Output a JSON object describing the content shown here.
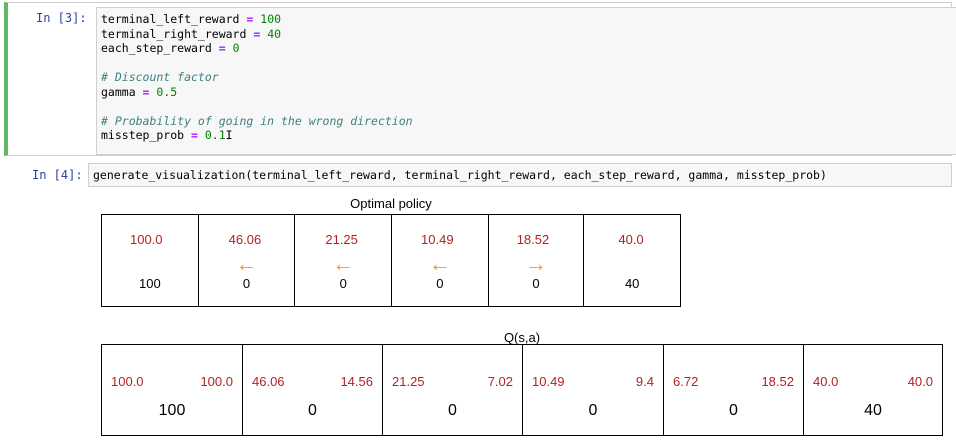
{
  "cell3": {
    "prompt": "In [3]:",
    "lines": [
      {
        "name": "terminal_left_reward",
        "op": " = ",
        "val": "100"
      },
      {
        "name": "terminal_right_reward",
        "op": " = ",
        "val": "40"
      },
      {
        "name": "each_step_reward",
        "op": " = ",
        "val": "0"
      },
      {
        "comment": ""
      },
      {
        "comment": "# Discount factor"
      },
      {
        "name": "gamma",
        "op": " = ",
        "val": "0.5"
      },
      {
        "comment": ""
      },
      {
        "comment": "# Probability of going in the wrong direction"
      },
      {
        "name": "misstep_prob",
        "op": " = ",
        "val": "0.1"
      }
    ]
  },
  "cell4": {
    "prompt": "In [4]:",
    "code": "generate_visualization(terminal_left_reward, terminal_right_reward, each_step_reward, gamma, misstep_prob)"
  },
  "policy": {
    "title": "Optimal policy",
    "cells": [
      {
        "value": "100.0",
        "arrow": "",
        "reward": "100"
      },
      {
        "value": "46.06",
        "arrow": "←",
        "reward": "0"
      },
      {
        "value": "21.25",
        "arrow": "←",
        "reward": "0"
      },
      {
        "value": "10.49",
        "arrow": "←",
        "reward": "0"
      },
      {
        "value": "18.52",
        "arrow": "→",
        "reward": "0"
      },
      {
        "value": "40.0",
        "arrow": "",
        "reward": "40"
      }
    ],
    "colors": {
      "value": "#b22222",
      "arrow": "#f0a000"
    }
  },
  "q": {
    "title": "Q(s,a)",
    "cells": [
      {
        "left": "100.0",
        "right": "100.0",
        "reward": "100"
      },
      {
        "left": "46.06",
        "right": "14.56",
        "reward": "0"
      },
      {
        "left": "21.25",
        "right": "7.02",
        "reward": "0"
      },
      {
        "left": "10.49",
        "right": "9.4",
        "reward": "0"
      },
      {
        "left": "6.72",
        "right": "18.52",
        "reward": "0"
      },
      {
        "left": "40.0",
        "right": "40.0",
        "reward": "40"
      }
    ]
  }
}
